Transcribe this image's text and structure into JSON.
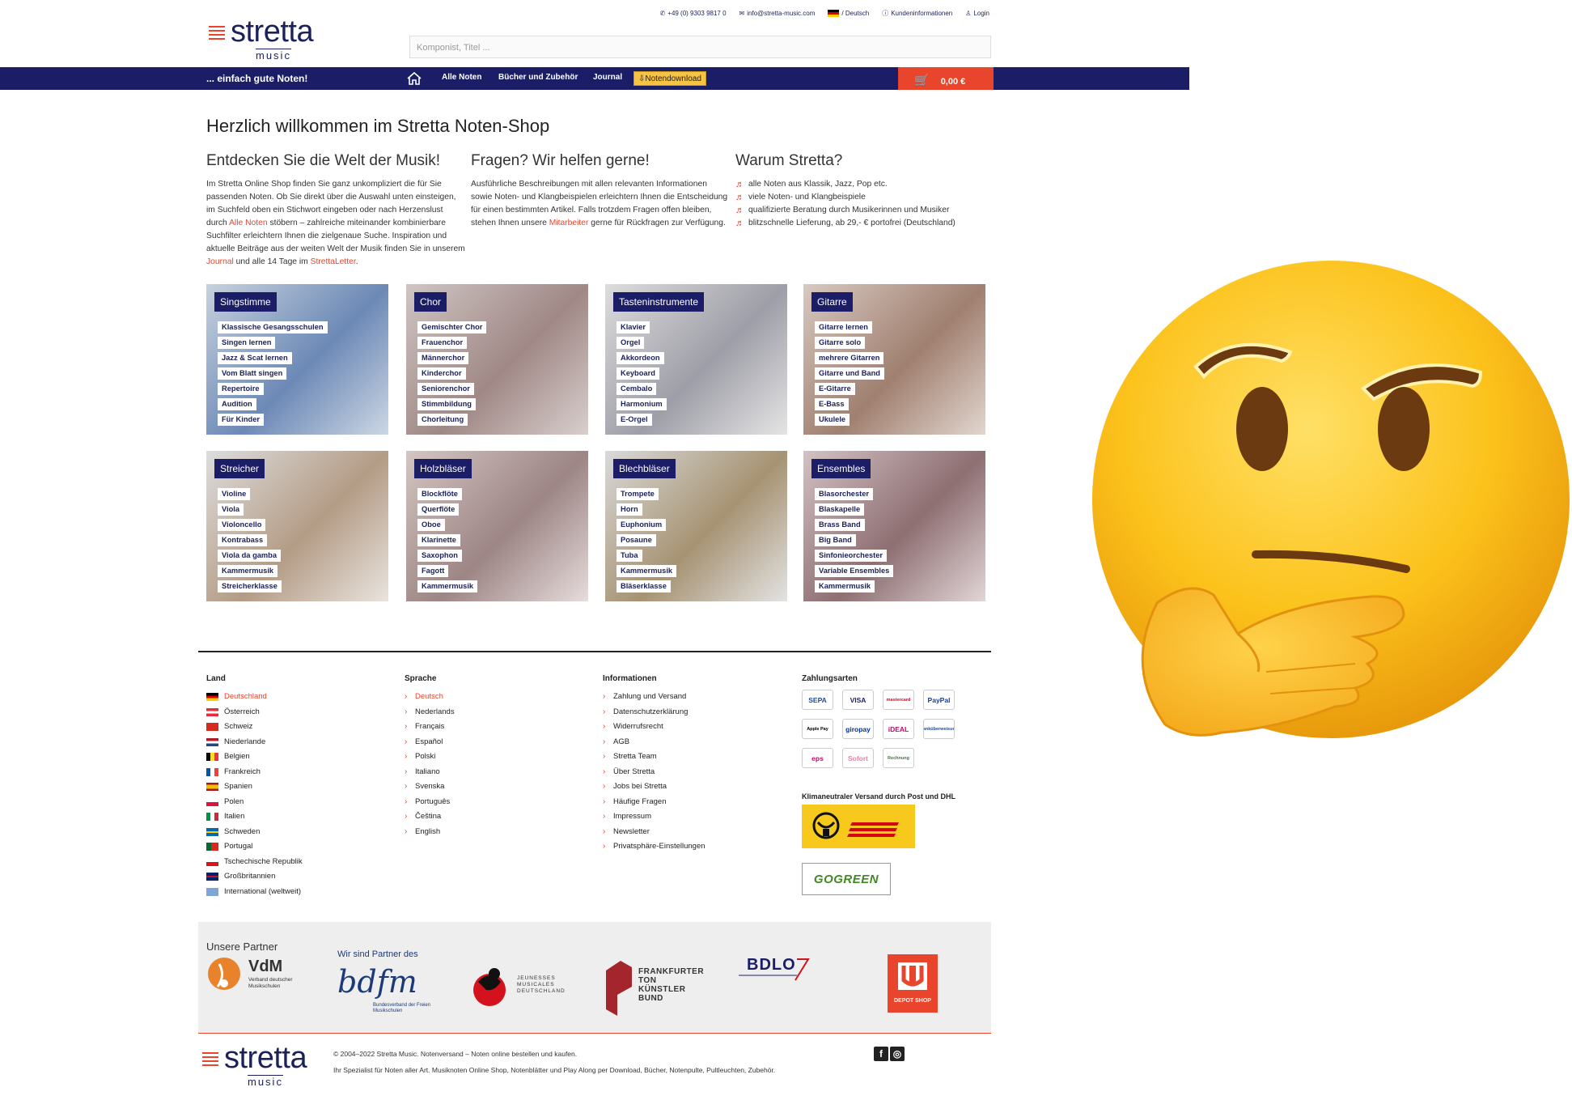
{
  "topbar": {
    "phone": "+49 (0) 9303 9817 0",
    "email": "info@stretta-music.com",
    "language": "/ Deutsch",
    "customer_info": "Kundeninformationen",
    "login": "Login"
  },
  "logo": {
    "word": "stretta",
    "sub": "music"
  },
  "search": {
    "placeholder": "Komponist, Titel ..."
  },
  "nav": {
    "slogan": "... einfach gute Noten!",
    "items": [
      "Alle Noten",
      "Bücher und Zubehör",
      "Journal"
    ],
    "download": "Notendownload",
    "cart": "0,00 €"
  },
  "welcome_title": "Herzlich willkommen im Stretta Noten-Shop",
  "col1": {
    "title": "Entdecken Sie die Welt der Musik!",
    "text_a": "Im Stretta Online Shop finden Sie ganz unkompliziert die für Sie passenden Noten. Ob Sie direkt über die Auswahl unten einsteigen, im Suchfeld oben ein Stichwort eingeben oder nach Herzenslust durch ",
    "link_a": "Alle Noten",
    "text_b": " stöbern – zahlreiche miteinander kombinierbare Suchfilter erleichtern Ihnen die zielgenaue Suche. Inspiration und aktuelle Beiträge aus der weiten Welt der Musik finden Sie in unserem ",
    "link_b": "Journal",
    "text_c": " und alle 14 Tage im ",
    "link_c": "StrettaLetter",
    "text_d": "."
  },
  "col2": {
    "title": "Fragen? Wir helfen gerne!",
    "text_a": "Ausführliche Beschreibungen mit allen relevanten Informationen sowie Noten- und Klangbeispielen erleichtern Ihnen die Entscheidung für einen bestimmten Artikel. Falls trotzdem Fragen offen bleiben, stehen Ihnen unsere ",
    "link_a": "Mitarbeiter",
    "text_b": " gerne für Rückfragen zur Verfügung."
  },
  "col3": {
    "title": "Warum Stretta?",
    "items": [
      "alle Noten aus Klassik, Jazz, Pop etc.",
      "viele Noten- und Klangbeispiele",
      "qualifizierte Beratung durch Musikerinnen und Musiker",
      "blitzschnelle Lieferung, ab 29,- € portofrei (Deutschland)"
    ]
  },
  "categories": [
    {
      "title": "Singstimme",
      "links": [
        "Klassische Gesangsschulen",
        "Singen lernen",
        "Jazz & Scat lernen",
        "Vom Blatt singen",
        "Repertoire",
        "Audition",
        "Für Kinder"
      ]
    },
    {
      "title": "Chor",
      "links": [
        "Gemischter Chor",
        "Frauenchor",
        "Männerchor",
        "Kinderchor",
        "Seniorenchor",
        "Stimmbildung",
        "Chorleitung"
      ]
    },
    {
      "title": "Tasteninstrumente",
      "links": [
        "Klavier",
        "Orgel",
        "Akkordeon",
        "Keyboard",
        "Cembalo",
        "Harmonium",
        "E-Orgel"
      ]
    },
    {
      "title": "Gitarre",
      "links": [
        "Gitarre lernen",
        "Gitarre solo",
        "mehrere Gitarren",
        "Gitarre und Band",
        "E-Gitarre",
        "E-Bass",
        "Ukulele"
      ]
    },
    {
      "title": "Streicher",
      "links": [
        "Violine",
        "Viola",
        "Violoncello",
        "Kontrabass",
        "Viola da gamba",
        "Kammermusik",
        "Streicherklasse"
      ]
    },
    {
      "title": "Holzbläser",
      "links": [
        "Blockflöte",
        "Querflöte",
        "Oboe",
        "Klarinette",
        "Saxophon",
        "Fagott",
        "Kammermusik"
      ]
    },
    {
      "title": "Blechbläser",
      "links": [
        "Trompete",
        "Horn",
        "Euphonium",
        "Posaune",
        "Tuba",
        "Kammermusik",
        "Bläserklasse"
      ]
    },
    {
      "title": "Ensembles",
      "links": [
        "Blasorchester",
        "Blaskapelle",
        "Brass Band",
        "Big Band",
        "Sinfonieorchester",
        "Variable Ensembles",
        "Kammermusik"
      ]
    }
  ],
  "footer": {
    "country_title": "Land",
    "countries": [
      "Deutschland",
      "Österreich",
      "Schweiz",
      "Niederlande",
      "Belgien",
      "Frankreich",
      "Spanien",
      "Polen",
      "Italien",
      "Schweden",
      "Portugal",
      "Tschechische Republik",
      "Großbritannien",
      "International (weltweit)"
    ],
    "language_title": "Sprache",
    "languages": [
      "Deutsch",
      "Nederlands",
      "Français",
      "Español",
      "Polski",
      "Italiano",
      "Svenska",
      "Português",
      "Čeština",
      "English"
    ],
    "info_title": "Informationen",
    "infos": [
      "Zahlung und Versand",
      "Datenschutzerklärung",
      "Widerrufsrecht",
      "AGB",
      "Stretta Team",
      "Über Stretta",
      "Jobs bei Stretta",
      "Häufige Fragen",
      "Impressum",
      "Newsletter",
      "Privatsphäre-Einstellungen"
    ],
    "payment_title": "Zahlungsarten",
    "payments": [
      "SEPA",
      "VISA",
      "mastercard",
      "PayPal",
      "Apple Pay",
      "giropay",
      "iDEAL",
      "Banküberweisung",
      "eps",
      "Sofort",
      "Rechnung"
    ],
    "shipping_label": "Klimaneutraler Versand durch Post und DHL",
    "gogreen": "GOGREEN"
  },
  "partners": {
    "label": "Unsere Partner",
    "vdm_title": "VdM",
    "vdm_sub": "Verband deutscher Musikschulen",
    "bdfm_head": "Wir sind Partner des",
    "bdfm_name": "bdfm",
    "bdfm_sub": "Bundesverband der Freien Musikschulen",
    "jm": "JEUNESSES MUSICALES DEUTSCHLAND",
    "ftk": "FRANKFURTER TON KÜNSTLER BUND",
    "bdlo": "BDLO",
    "urtext": "DEPOT SHOP"
  },
  "copyright": {
    "line1": "© 2004–2022 Stretta Music. Notenversand – Noten online bestellen und kaufen.",
    "line2": "Ihr Spezialist für Noten aller Art. Musiknoten Online Shop, Notenblätter und Play Along per Download, Bücher, Notenpulte, Pultleuchten, Zubehör."
  },
  "colors": {
    "navy": "#1b1e66",
    "accent": "#e8452c",
    "download": "#f6c343"
  },
  "icons": [
    "phone-icon",
    "mail-icon",
    "info-icon",
    "user-icon",
    "home-icon",
    "cart-icon",
    "download-icon",
    "music-note-icon",
    "facebook-icon",
    "instagram-icon",
    "thinking-face-emoji"
  ]
}
